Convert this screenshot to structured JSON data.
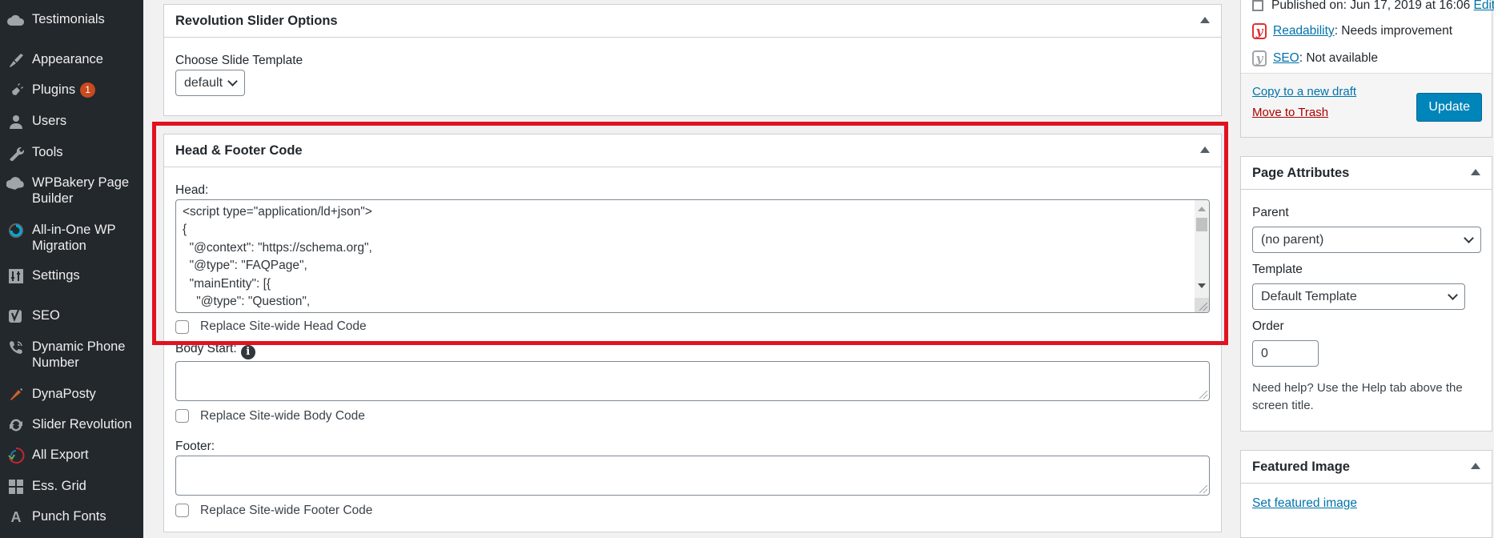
{
  "sidebar": {
    "items": [
      {
        "label": "Testimonials",
        "icon": "cloud-icon"
      },
      {
        "label": "Appearance",
        "icon": "paintbrush-icon"
      },
      {
        "label": "Plugins",
        "icon": "plugin-icon",
        "badge": "1"
      },
      {
        "label": "Users",
        "icon": "user-icon"
      },
      {
        "label": "Tools",
        "icon": "wrench-icon"
      },
      {
        "label": "WPBakery Page Builder",
        "icon": "wpbakery-cloud-icon"
      },
      {
        "label": "All-in-One WP Migration",
        "icon": "migration-icon"
      },
      {
        "label": "Settings",
        "icon": "settings-sliders-icon"
      },
      {
        "label": "SEO",
        "icon": "yoast-icon"
      },
      {
        "label": "Dynamic Phone Number",
        "icon": "phone-icon"
      },
      {
        "label": "DynaPosty",
        "icon": "dynaposty-icon"
      },
      {
        "label": "Slider Revolution",
        "icon": "refresh-icon"
      },
      {
        "label": "All Export",
        "icon": "export-icon"
      },
      {
        "label": "Ess. Grid",
        "icon": "grid-icon"
      },
      {
        "label": "Punch Fonts",
        "icon": "font-a-icon"
      }
    ]
  },
  "revslider_box": {
    "title": "Revolution Slider Options",
    "template_label": "Choose Slide Template",
    "template_value": "default"
  },
  "hfc_box": {
    "title": "Head & Footer Code",
    "head_label": "Head:",
    "head_code_lines": [
      "<script type=\"application/ld+json\">",
      "{",
      "  \"@context\": \"https://schema.org\",",
      "  \"@type\": \"FAQPage\",",
      "  \"mainEntity\": [{",
      "    \"@type\": \"Question\","
    ],
    "head_checkbox": "Replace Site-wide Head Code",
    "body_label": "Body Start:",
    "body_value": "",
    "body_checkbox": "Replace Site-wide Body Code",
    "footer_label": "Footer:",
    "footer_value": "",
    "footer_checkbox": "Replace Site-wide Footer Code"
  },
  "publish": {
    "published_text": "Published on: Jun 17, 2019 at 16:06",
    "edit_link": "Edit",
    "readability_link": "Readability",
    "readability_status": ": Needs improvement",
    "seo_link": "SEO",
    "seo_status": ": Not available",
    "copy_draft": "Copy to a new draft",
    "trash": "Move to Trash",
    "update": "Update",
    "readability_color": "#dc3232",
    "seo_color": "#a0a5aa"
  },
  "page_attributes": {
    "title": "Page Attributes",
    "parent_label": "Parent",
    "parent_value": "(no parent)",
    "template_label": "Template",
    "template_value": "Default Template",
    "order_label": "Order",
    "order_value": "0",
    "help_text": "Need help? Use the Help tab above the screen title."
  },
  "featured_image": {
    "title": "Featured Image",
    "set_link": "Set featured image"
  },
  "colors": {
    "highlight": "#e0131f",
    "primary": "#0085ba",
    "sidebar_bg": "#23282d"
  }
}
